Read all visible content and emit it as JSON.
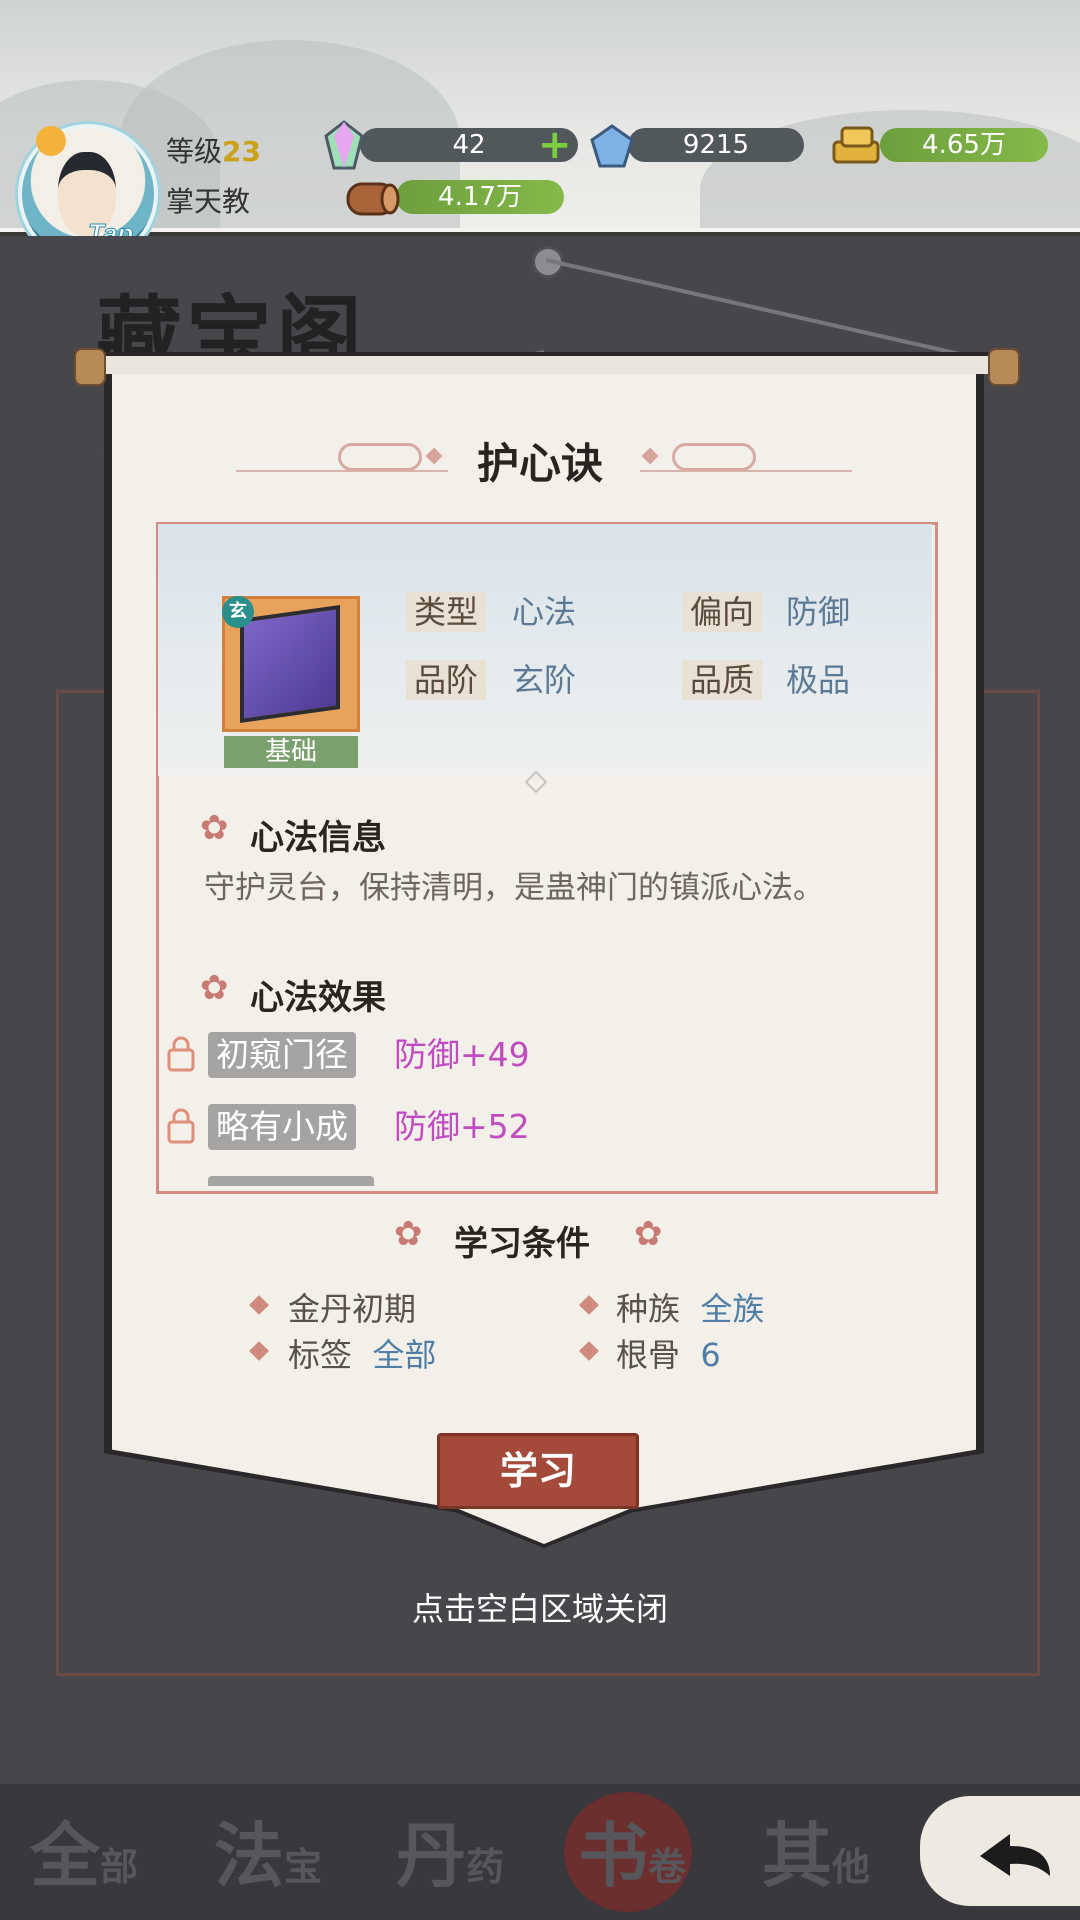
{
  "header": {
    "avatar_tap": "Tap",
    "level_label": "等级",
    "level_value": "23",
    "sect_name": "掌天教",
    "resources": {
      "spirit_crystal": "42",
      "blue_gem": "9215",
      "gold": "4.65万",
      "wood": "4.17万"
    }
  },
  "background": {
    "title": "藏宝阁",
    "tabs": [
      {
        "big": "全",
        "small": "部"
      },
      {
        "big": "法",
        "small": "宝"
      },
      {
        "big": "丹",
        "small": "药"
      },
      {
        "big": "书",
        "small": "卷"
      },
      {
        "big": "其",
        "small": "他"
      }
    ]
  },
  "dialog": {
    "title": "护心诀",
    "item": {
      "badge": "玄",
      "level_tag": "基础"
    },
    "attributes": [
      {
        "key": "类型",
        "value": "心法"
      },
      {
        "key": "偏向",
        "value": "防御"
      },
      {
        "key": "品阶",
        "value": "玄阶"
      },
      {
        "key": "品质",
        "value": "极品"
      }
    ],
    "info_heading": "心法信息",
    "description": "守护灵台，保持清明，是蛊神门的镇派心法。",
    "effect_heading": "心法效果",
    "effects": [
      {
        "stage": "初窥门径",
        "bonus": "防御+49"
      },
      {
        "stage": "略有小成",
        "bonus": "防御+52"
      }
    ],
    "requirements_heading": "学习条件",
    "requirements": [
      {
        "label": "金丹初期",
        "value": ""
      },
      {
        "label": "种族",
        "value": "全族"
      },
      {
        "label": "标签",
        "value": "全部"
      },
      {
        "label": "根骨",
        "value": "6"
      }
    ],
    "learn_button": "学习",
    "close_hint": "点击空白区域关闭"
  },
  "colors": {
    "accent_red": "#a34a3a",
    "effect_purple": "#c04cc0",
    "value_blue": "#4f7fa6"
  }
}
